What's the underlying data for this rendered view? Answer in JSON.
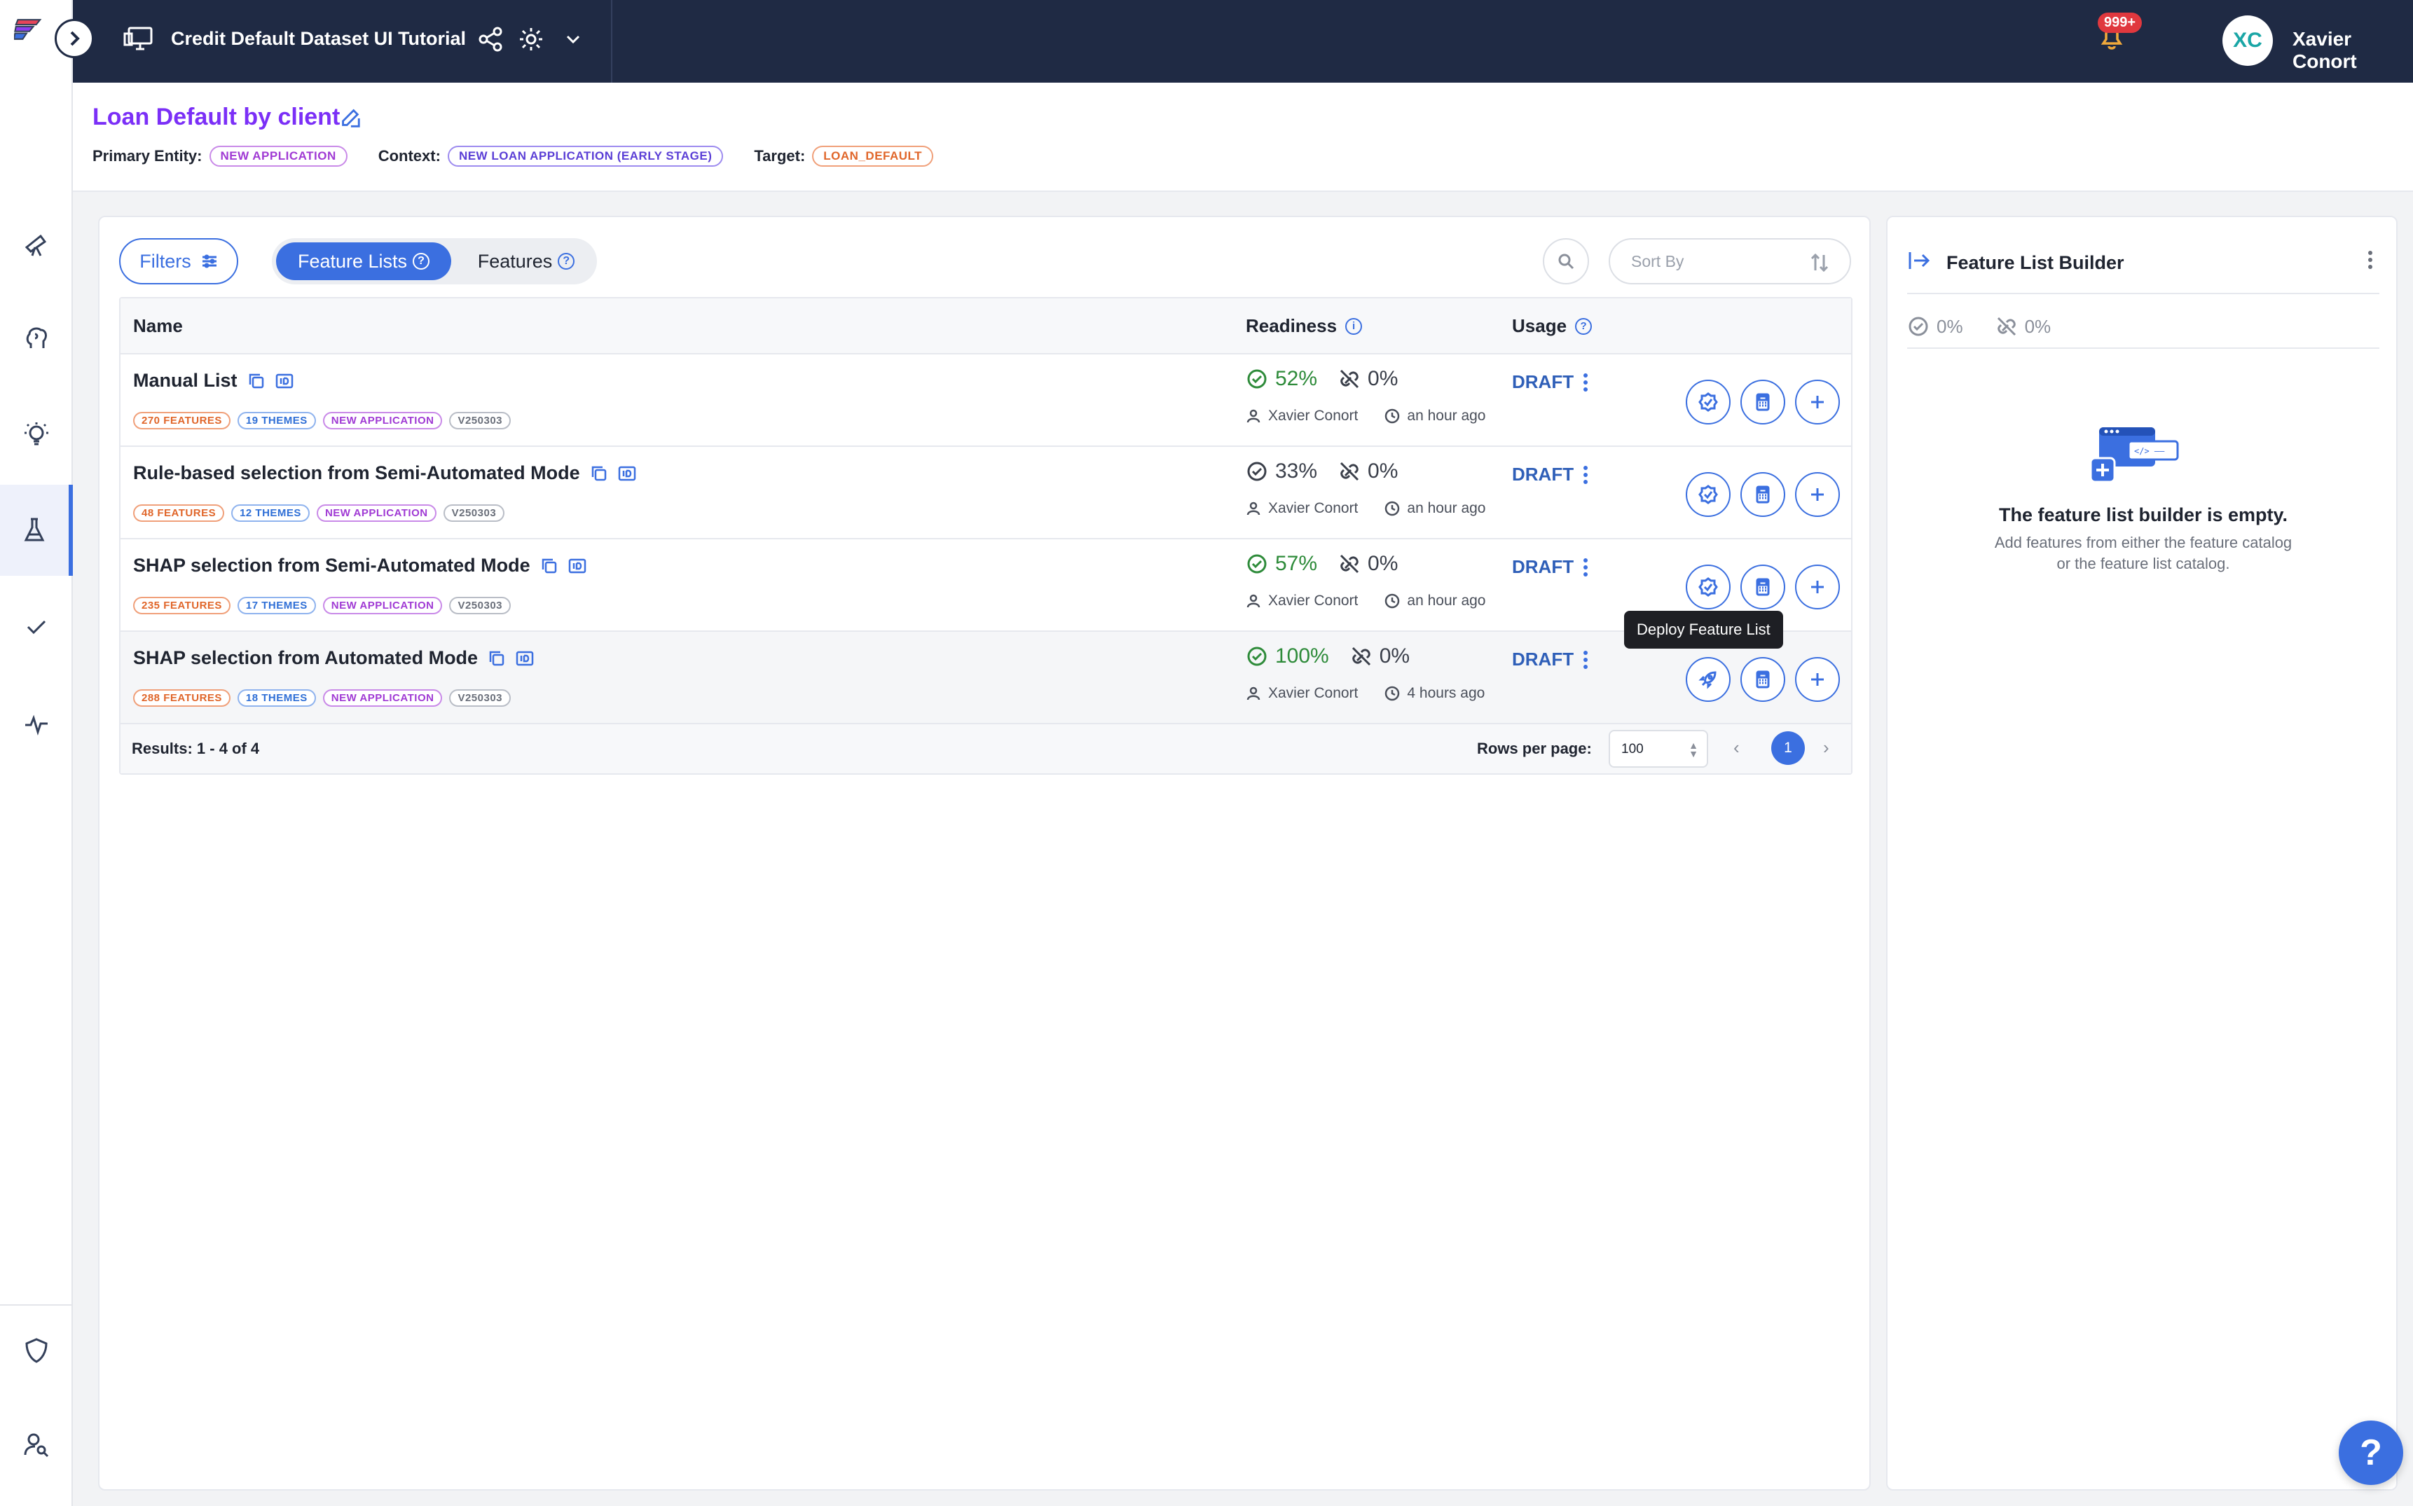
{
  "topbar": {
    "catalog_title": "Credit Default Dataset UI Tutorial",
    "notification_count": "999+",
    "user_initials": "XC",
    "user_name": "Xavier Conort"
  },
  "header": {
    "title": "Loan Default by client",
    "primary_entity_label": "Primary Entity:",
    "primary_entity": "NEW APPLICATION",
    "context_label": "Context:",
    "context": "NEW LOAN APPLICATION (EARLY STAGE)",
    "target_label": "Target:",
    "target": "LOAN_DEFAULT"
  },
  "toolbar": {
    "filters_label": "Filters",
    "tab_feature_lists": "Feature Lists",
    "tab_features": "Features",
    "sort_placeholder": "Sort By"
  },
  "table": {
    "col_name": "Name",
    "col_readiness": "Readiness",
    "col_usage": "Usage",
    "rows": [
      {
        "name": "Manual List",
        "features": "270 FEATURES",
        "themes": "19 THEMES",
        "entity": "NEW APPLICATION",
        "version": "V250303",
        "readiness": "52%",
        "online": "0%",
        "owner": "Xavier Conort",
        "time": "an hour ago",
        "status": "DRAFT"
      },
      {
        "name": "Rule-based selection from Semi-Automated Mode",
        "features": "48 FEATURES",
        "themes": "12 THEMES",
        "entity": "NEW APPLICATION",
        "version": "V250303",
        "readiness": "33%",
        "online": "0%",
        "owner": "Xavier Conort",
        "time": "an hour ago",
        "status": "DRAFT"
      },
      {
        "name": "SHAP selection from Semi-Automated Mode",
        "features": "235 FEATURES",
        "themes": "17 THEMES",
        "entity": "NEW APPLICATION",
        "version": "V250303",
        "readiness": "57%",
        "online": "0%",
        "owner": "Xavier Conort",
        "time": "an hour ago",
        "status": "DRAFT"
      },
      {
        "name": "SHAP selection from Automated Mode",
        "features": "288 FEATURES",
        "themes": "18 THEMES",
        "entity": "NEW APPLICATION",
        "version": "V250303",
        "readiness": "100%",
        "online": "0%",
        "owner": "Xavier Conort",
        "time": "4 hours ago",
        "status": "DRAFT"
      }
    ],
    "results": "Results: 1 - 4 of 4",
    "rows_per_page_label": "Rows per page:",
    "rows_per_page": "100",
    "current_page": "1"
  },
  "tooltip": "Deploy Feature List",
  "builder": {
    "title": "Feature List Builder",
    "readiness": "0%",
    "online": "0%",
    "empty_title": "The feature list builder is empty.",
    "empty_line1": "Add features from either the feature catalog",
    "empty_line2": "or the feature list catalog."
  },
  "help_label": "?",
  "colors": {
    "accent": "#3b6fe0",
    "title_purple": "#7b2ff7",
    "topbar": "#1f2a44",
    "ready_green": "#2e8b3a",
    "draft_blue": "#2f5fb8"
  }
}
